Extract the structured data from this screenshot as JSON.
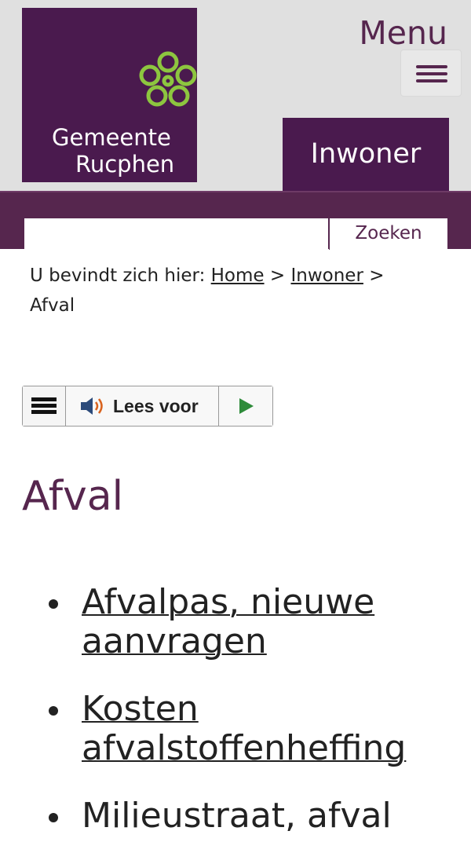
{
  "header": {
    "logo_line1": "Gemeente",
    "logo_line2": "Rucphen",
    "menu_label": "Menu",
    "nav_tab": "Inwoner",
    "colors": {
      "brand_purple": "#4a1a4e",
      "band_purple": "#56264e",
      "logo_flower": "#8dc63f",
      "header_bg": "#e0e0e0"
    }
  },
  "search": {
    "value": "",
    "placeholder": "",
    "button_label": "Zoeken"
  },
  "breadcrumb": {
    "prefix": "U bevindt zich hier:",
    "items": [
      "Home",
      "Inwoner"
    ],
    "separator": ">",
    "current": "Afval"
  },
  "readspeaker": {
    "menu_icon": "hamburger-icon",
    "speaker_icon": "speaker-icon",
    "listen_label": "Lees voor",
    "play_icon": "play-icon"
  },
  "main": {
    "title": "Afval",
    "links": [
      {
        "line1": "Afvalpas, nieuwe",
        "line2": "aanvragen"
      },
      {
        "line1": "Kosten",
        "line2": "afvalstoffenheffing"
      },
      {
        "line1": "Milieustraat, afval"
      }
    ]
  }
}
